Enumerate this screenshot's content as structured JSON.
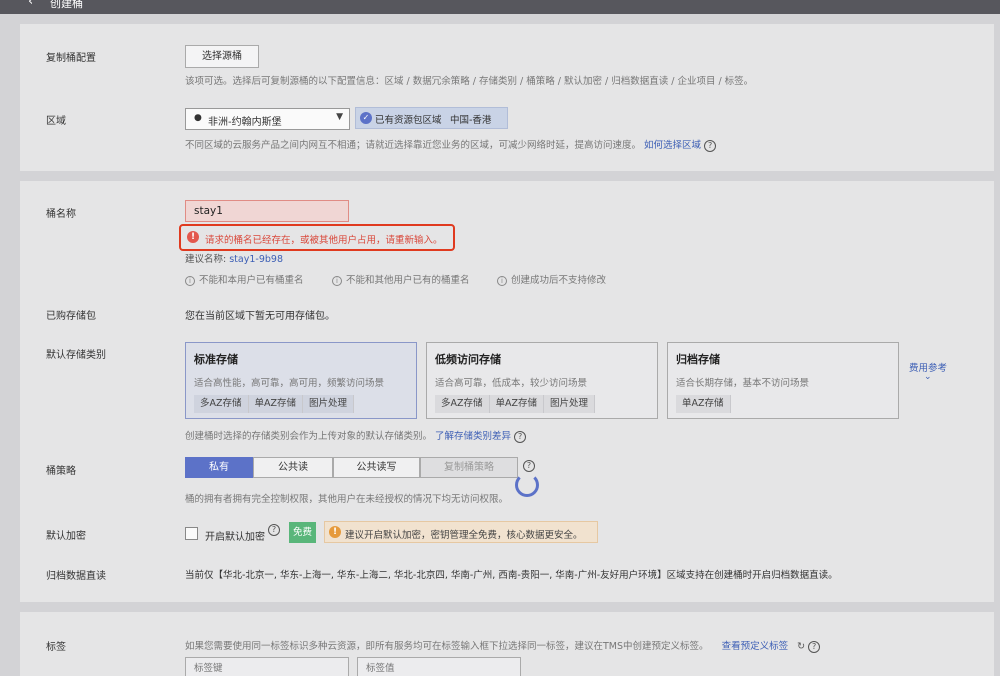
{
  "header": {
    "back_glyph": "‹",
    "title": "创建桶"
  },
  "replication": {
    "label": "复制桶配置",
    "button_label": "选择源桶",
    "hint": "该项可选。选择后可复制源桶的以下配置信息：区域 / 数据冗余策略 / 存储类别 / 桶策略 / 默认加密 / 归档数据直读 / 企业项目 / 标签。"
  },
  "region": {
    "label": "区域",
    "selected": "非洲-约翰内斯堡",
    "badge_text": "已有资源包区域",
    "badge_region": "中国-香港",
    "hint": "不同区域的云服务产品之间内网互不相通；请就近选择靠近您业务的区域，可减少网络时延，提高访问速度。",
    "hint_link": "如何选择区域"
  },
  "bucket_name": {
    "label": "桶名称",
    "value": "stay1",
    "error": "请求的桶名已经存在，或被其他用户占用，请重新输入。",
    "suggest_label": "建议名称:",
    "suggest_value": "stay1-9b98",
    "rules": [
      "不能和本用户已有桶重名",
      "不能和其他用户已有的桶重名",
      "创建成功后不支持修改"
    ]
  },
  "package": {
    "label": "已购存储包",
    "text": "您在当前区域下暂无可用存储包。"
  },
  "storage_class": {
    "label": "默认存储类别",
    "options": [
      {
        "title": "标准存储",
        "desc": "适合高性能，高可靠，高可用，频繁访问场景",
        "tags": [
          "多AZ存储",
          "单AZ存储",
          "图片处理"
        ]
      },
      {
        "title": "低频访问存储",
        "desc": "适合高可靠，低成本，较少访问场景",
        "tags": [
          "多AZ存储",
          "单AZ存储",
          "图片处理"
        ]
      },
      {
        "title": "归档存储",
        "desc": "适合长期存储，基本不访问场景",
        "tags": [
          "单AZ存储"
        ]
      }
    ],
    "fee_link": "费用参考",
    "hint": "创建桶时选择的存储类别会作为上传对象的默认存储类别。",
    "hint_link": "了解存储类别差异"
  },
  "policy": {
    "label": "桶策略",
    "options": [
      "私有",
      "公共读",
      "公共读写",
      "复制桶策略"
    ],
    "hint": "桶的拥有者拥有完全控制权限，其他用户在未经授权的情况下均无访问权限。"
  },
  "encryption": {
    "label": "默认加密",
    "checkbox_label": "开启默认加密",
    "free_badge": "免费",
    "tip": "建议开启默认加密，密钥管理全免费，核心数据更安全。"
  },
  "archive": {
    "label": "归档数据直读",
    "text": "当前仅【华北-北京一, 华东-上海一, 华东-上海二, 华北-北京四, 华南-广州, 西南-贵阳一, 华南-广州-友好用户环境】区域支持在创建桶时开启归档数据直读。"
  },
  "tags": {
    "label": "标签",
    "hint": "如果您需要使用同一标签标识多种云资源，即所有服务均可在标签输入框下拉选择同一标签，建议在TMS中创建预定义标签。",
    "hint_link": "查看预定义标签",
    "key_placeholder": "标签键",
    "value_placeholder": "标签值"
  },
  "colors": {
    "primary": "#5c72c8",
    "error": "#e3584d",
    "warning": "#e69a3c",
    "highlight": "#e03a1f",
    "free_badge": "#59b67a"
  }
}
